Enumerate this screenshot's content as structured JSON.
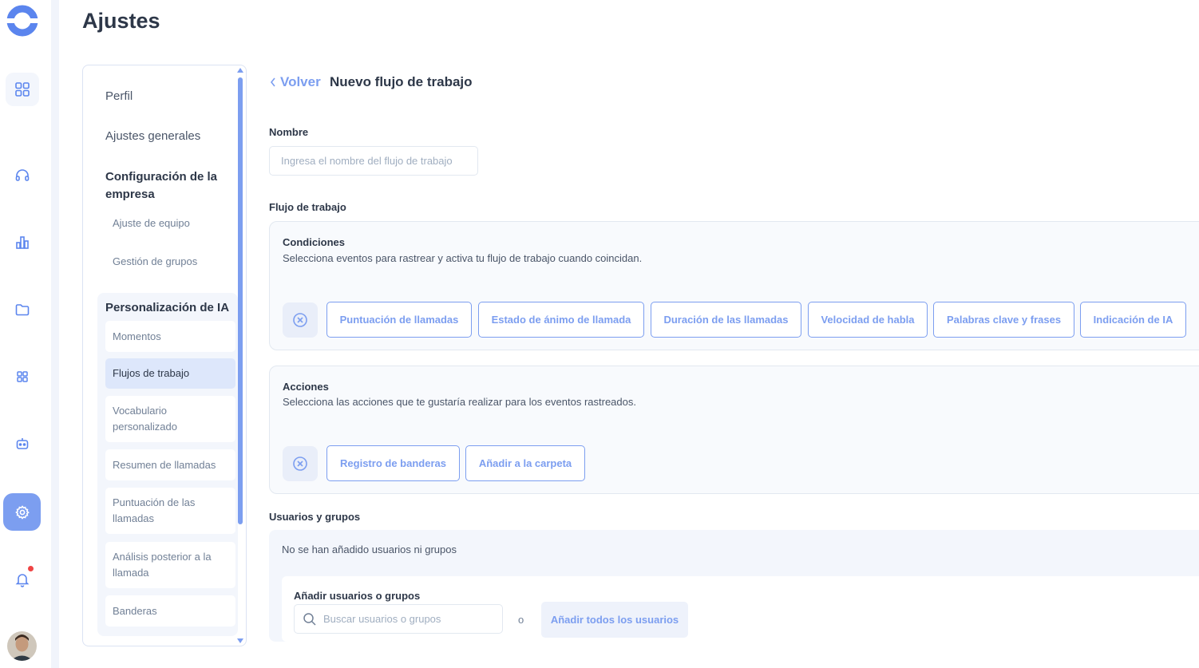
{
  "app": {
    "page_title": "Ajustes"
  },
  "settings_nav": {
    "perfil": "Perfil",
    "ajustes_generales": "Ajustes generales",
    "config_empresa": "Configuración de la empresa",
    "ajuste_equipo": "Ajuste de equipo",
    "gestion_grupos": "Gestión de grupos",
    "personalizacion_ia": "Personalización de IA",
    "ai_items": [
      "Momentos",
      "Flujos de trabajo",
      "Vocabulario personalizado",
      "Resumen de llamadas",
      "Puntuación de las llamadas",
      "Análisis posterior a la llamada",
      "Banderas"
    ]
  },
  "form": {
    "back_label": "Volver",
    "title": "Nuevo flujo de trabajo",
    "name_label": "Nombre",
    "name_placeholder": "Ingresa el nombre del flujo de trabajo",
    "workflow_label": "Flujo de trabajo",
    "conditions": {
      "title": "Condiciones",
      "description": "Selecciona eventos para rastrear y activa tu flujo de trabajo cuando coincidan.",
      "chips": [
        "Puntuación de llamadas",
        "Estado de ánimo de llamada",
        "Duración de las llamadas",
        "Velocidad de habla",
        "Palabras clave y frases",
        "Indicación de IA"
      ]
    },
    "actions": {
      "title": "Acciones",
      "description": "Selecciona las acciones que te gustaría realizar para los eventos rastreados.",
      "chips": [
        "Registro de banderas",
        "Añadir a la carpeta"
      ]
    },
    "users": {
      "label": "Usuarios y grupos",
      "empty": "No se han añadido usuarios ni grupos",
      "add_label": "Añadir usuarios o grupos",
      "search_placeholder": "Buscar usuarios o grupos",
      "or": "o",
      "add_all": "Añadir todos los usuarios"
    }
  },
  "colors": {
    "accent": "#7c9ef0",
    "active_bg": "#dde7fb",
    "notification": "#ef4444"
  }
}
